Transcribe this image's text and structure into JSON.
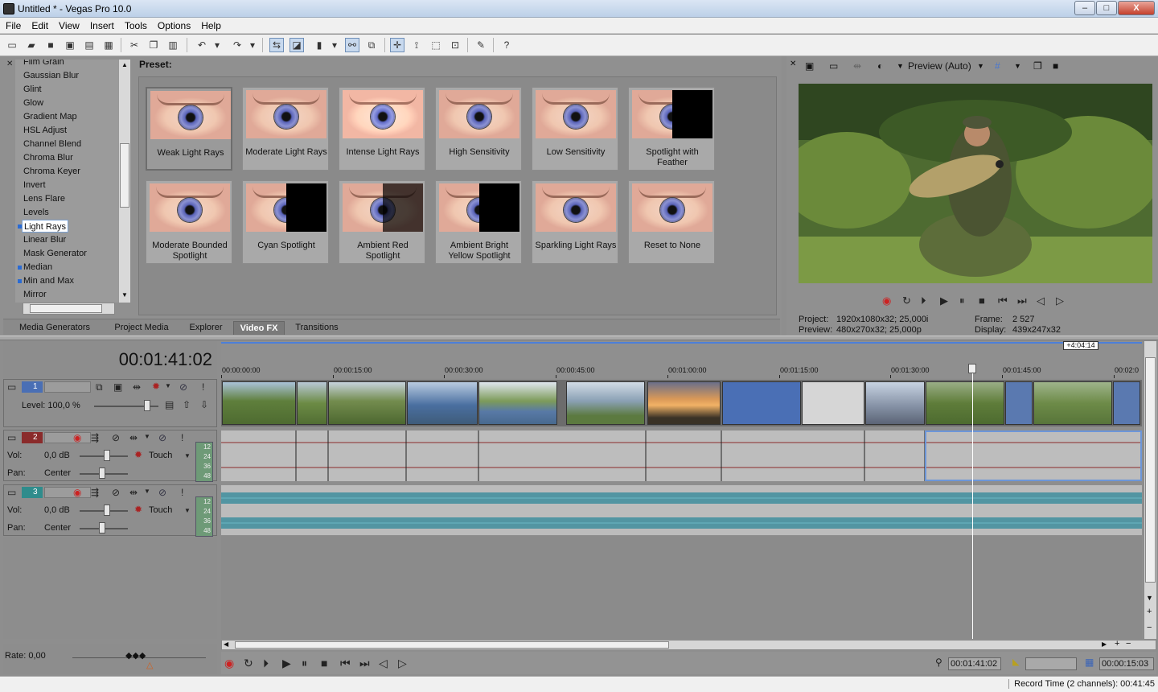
{
  "window": {
    "title": "Untitled * - Vegas Pro 10.0",
    "min_label": "–",
    "max_label": "□",
    "close_label": "X"
  },
  "menu": [
    "File",
    "Edit",
    "View",
    "Insert",
    "Tools",
    "Options",
    "Help"
  ],
  "toolbar_icons": [
    "new-icon",
    "open-icon",
    "save-icon",
    "save-as-icon",
    "render-icon",
    "properties-icon",
    "cut-icon",
    "copy-icon",
    "paste-icon",
    "undo-icon",
    "redo-icon",
    "auto-ripple-icon",
    "lock-envelopes-icon",
    "ignore-grouping-icon",
    "auto-crossfade-icon",
    "snapping-icon",
    "normal-edit-tool-icon",
    "envelope-tool-icon",
    "selection-tool-icon",
    "zoom-tool-icon",
    "ripple-edit-icon",
    "whats-this-help-icon"
  ],
  "fx_list": {
    "items": [
      {
        "label": "Film Grain",
        "mark": false
      },
      {
        "label": "Gaussian Blur",
        "mark": false
      },
      {
        "label": "Glint",
        "mark": false
      },
      {
        "label": "Glow",
        "mark": false
      },
      {
        "label": "Gradient Map",
        "mark": false
      },
      {
        "label": "HSL Adjust",
        "mark": false
      },
      {
        "label": "Channel Blend",
        "mark": false
      },
      {
        "label": "Chroma Blur",
        "mark": false
      },
      {
        "label": "Chroma Keyer",
        "mark": false
      },
      {
        "label": "Invert",
        "mark": false
      },
      {
        "label": "Lens Flare",
        "mark": false
      },
      {
        "label": "Levels",
        "mark": false
      },
      {
        "label": "Light Rays",
        "mark": true,
        "selected": true
      },
      {
        "label": "Linear Blur",
        "mark": false
      },
      {
        "label": "Mask Generator",
        "mark": false
      },
      {
        "label": "Median",
        "mark": true
      },
      {
        "label": "Min and Max",
        "mark": true
      },
      {
        "label": "Mirror",
        "mark": false
      }
    ]
  },
  "presets": {
    "label": "Preset:",
    "items": [
      {
        "label": "Weak Light Rays",
        "style": "normal",
        "selected": true
      },
      {
        "label": "Moderate Light Rays",
        "style": "normal"
      },
      {
        "label": "Intense Light Rays",
        "style": "bright"
      },
      {
        "label": "High Sensitivity",
        "style": "normal"
      },
      {
        "label": "Low Sensitivity",
        "style": "normal"
      },
      {
        "label": "Spotlight with Feather",
        "style": "dark-right"
      },
      {
        "label": "Moderate Bounded Spotlight",
        "style": "normal"
      },
      {
        "label": "Cyan Spotlight",
        "style": "dark-right"
      },
      {
        "label": "Ambient Red Spotlight",
        "style": "dim-right"
      },
      {
        "label": "Ambient Bright Yellow Spotlight",
        "style": "dark-right"
      },
      {
        "label": "Sparkling Light Rays",
        "style": "normal"
      },
      {
        "label": "Reset to None",
        "style": "normal"
      }
    ]
  },
  "tabs": [
    {
      "label": "Media Generators"
    },
    {
      "label": "Project Media"
    },
    {
      "label": "Explorer"
    },
    {
      "label": "Video FX",
      "active": true
    },
    {
      "label": "Transitions"
    }
  ],
  "preview": {
    "quality": "Preview (Auto)",
    "project_label": "Project:",
    "project_value": "1920x1080x32; 25,000i",
    "preview_label": "Preview:",
    "preview_value": "480x270x32; 25,000p",
    "frame_label": "Frame:",
    "frame_value": "2 527",
    "display_label": "Display:",
    "display_value": "439x247x32"
  },
  "timeline": {
    "current_time": "00:01:41:02",
    "marker": "+4:04:14",
    "ruler_ticks": [
      "00:00:00:00",
      "00:00:15:00",
      "00:00:30:00",
      "00:00:45:00",
      "00:01:00:00",
      "00:01:15:00",
      "00:01:30:00",
      "00:01:45:00",
      "00:02:0"
    ],
    "tracks": [
      {
        "number": "1",
        "type": "video",
        "level_label": "Level: 100,0 %"
      },
      {
        "number": "2",
        "type": "audio",
        "vol_label": "Vol:",
        "vol_value": "0,0 dB",
        "pan_label": "Pan:",
        "pan_value": "Center",
        "mode": "Touch",
        "meter": [
          "12",
          "24",
          "36",
          "48"
        ]
      },
      {
        "number": "3",
        "type": "audio",
        "vol_label": "Vol:",
        "vol_value": "0,0 dB",
        "pan_label": "Pan:",
        "pan_value": "Center",
        "mode": "Touch",
        "meter": [
          "12",
          "24",
          "36",
          "48"
        ]
      }
    ],
    "rate": "Rate: 0,00",
    "cursor_time": "00:01:41:02",
    "selection_length": "00:00:15:03"
  },
  "status": {
    "text": "Record Time (2 channels): 00:41:45"
  },
  "colors": {
    "accent": "#4c7fd8",
    "track_video": "#4a6fb5",
    "track_audio_2": "#8a2b2b",
    "track_audio_3": "#2f8c8c",
    "waveform": "#3f8e9e"
  }
}
